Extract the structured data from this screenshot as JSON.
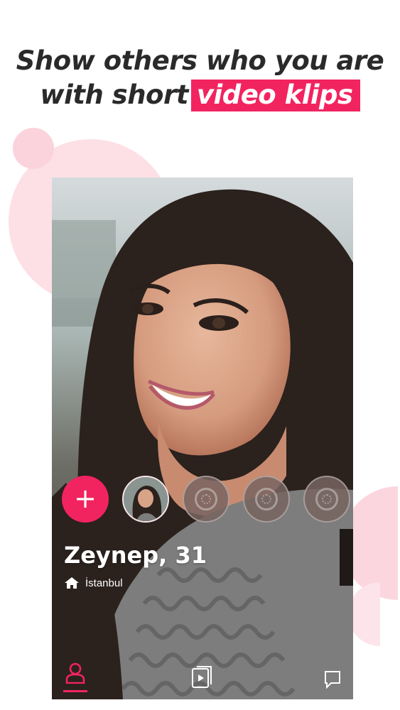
{
  "headline": {
    "line1": "Show others who you are",
    "line2_prefix": "with short",
    "line2_highlight": "video klips"
  },
  "colors": {
    "accent": "#f2245f",
    "blob": "#fde0e6",
    "text_dark": "#2a2a2a"
  },
  "profile": {
    "name_age": "Zeynep, 31",
    "city": "İstanbul"
  },
  "stories": {
    "add_label": "+",
    "items": [
      {
        "type": "photo",
        "icon": "avatar"
      },
      {
        "type": "empty",
        "icon": "video-placeholder-icon"
      },
      {
        "type": "empty",
        "icon": "video-placeholder-icon"
      },
      {
        "type": "empty",
        "icon": "video-placeholder-icon"
      }
    ]
  },
  "tabs": [
    {
      "name": "profile",
      "icon": "person-icon",
      "active": true
    },
    {
      "name": "videos",
      "icon": "video-cards-icon",
      "active": false
    },
    {
      "name": "chat",
      "icon": "chat-bubble-icon",
      "active": false
    }
  ]
}
